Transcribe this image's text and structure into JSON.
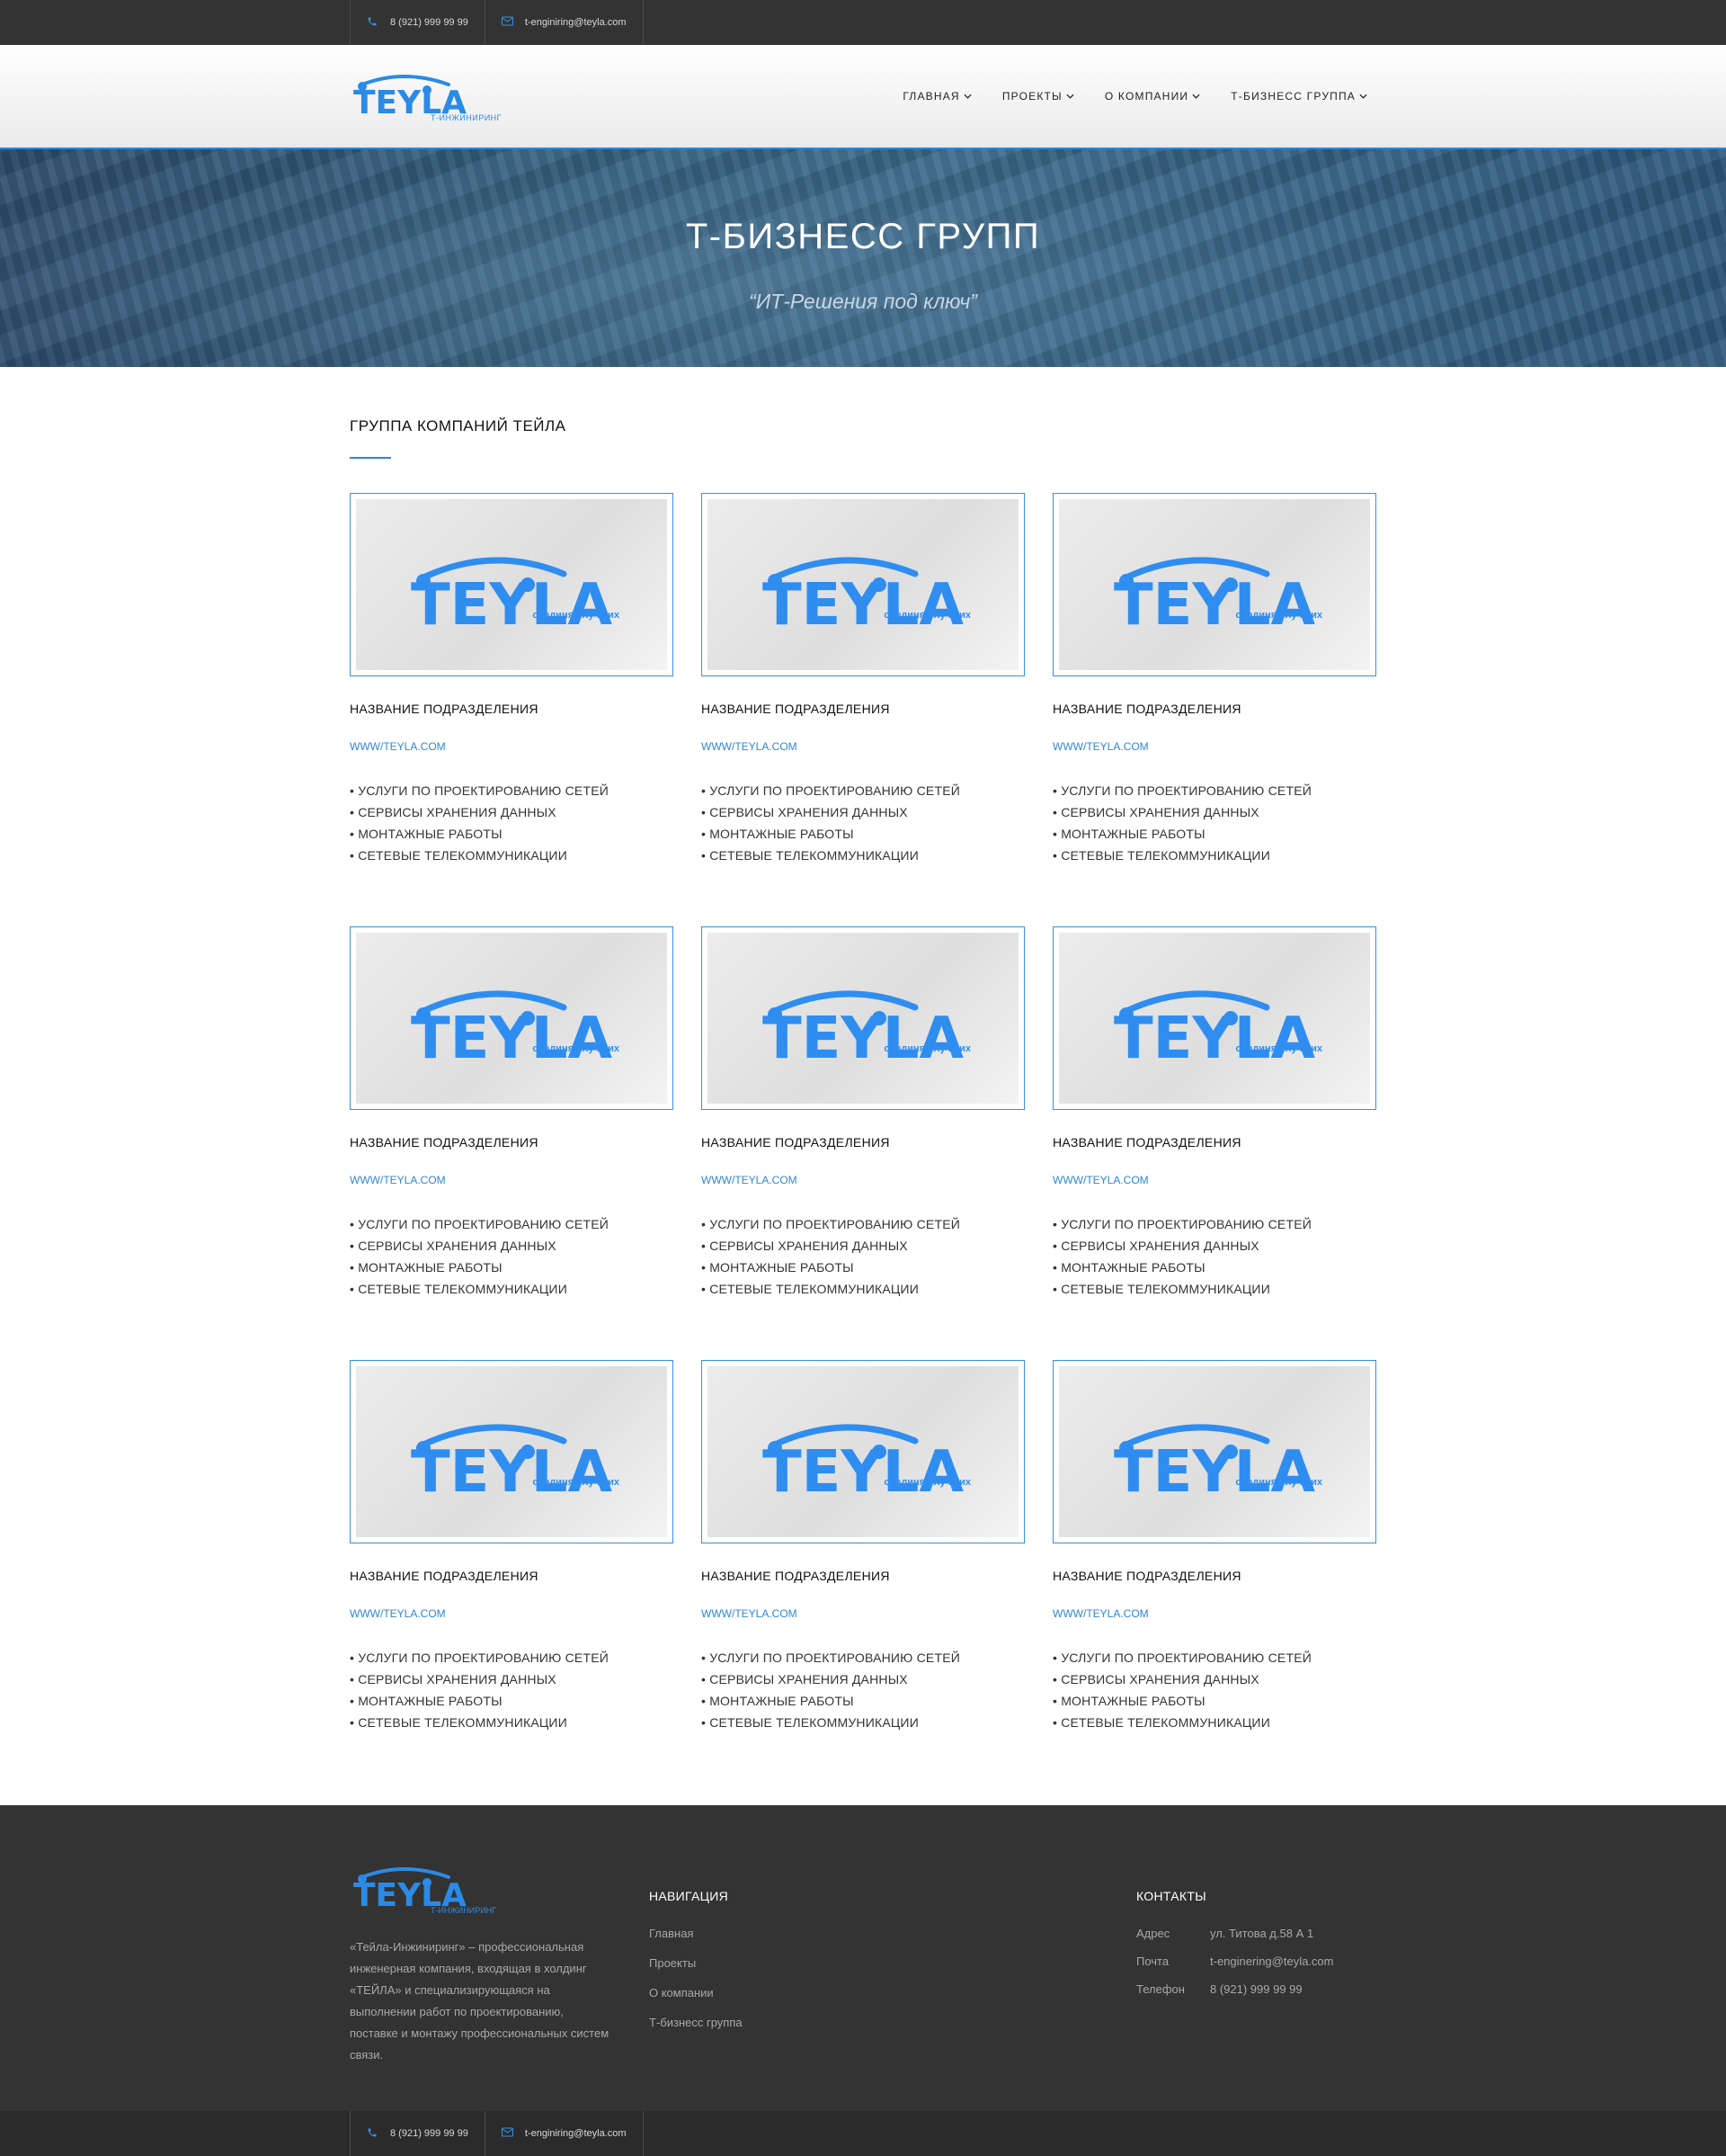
{
  "topbar": {
    "phone": "8 (921) 999 99 99",
    "email": "t-enginiring@teyla.com"
  },
  "brand": {
    "logo_text": "TEYLA",
    "logo_sub": "Т-ИНЖИНИРИНГ",
    "accent": "#2b8ae6",
    "dark": "#333333"
  },
  "nav": {
    "items": [
      {
        "label": "ГЛАВНАЯ"
      },
      {
        "label": "ПРОЕКТЫ"
      },
      {
        "label": "О КОМПАНИИ"
      },
      {
        "label": "Т-БИЗНЕСС ГРУППА"
      }
    ]
  },
  "hero": {
    "title": "Т-БИЗНЕСС ГРУПП",
    "quote": "“ИТ-Решения под ключ”"
  },
  "section": {
    "title": "ГРУППА КОМПАНИЙ ТЕЙЛА"
  },
  "cards": [
    {
      "logo_text": "TEYLA",
      "tagline": "соединяя лучших",
      "name": "НАЗВАНИЕ ПОДРАЗДЕЛЕНИЯ",
      "link": "WWW/TEYLA.COM",
      "services": [
        "• УСЛУГИ ПО ПРОЕКТИРОВАНИЮ СЕТЕЙ",
        "• СЕРВИСЫ ХРАНЕНИЯ ДАННЫХ",
        "• МОНТАЖНЫЕ РАБОТЫ",
        "• СЕТЕВЫЕ ТЕЛЕКОММУНИКАЦИИ"
      ]
    },
    {
      "logo_text": "TEYLA",
      "tagline": "соединяя лучших",
      "name": "НАЗВАНИЕ ПОДРАЗДЕЛЕНИЯ",
      "link": "WWW/TEYLA.COM",
      "services": [
        "• УСЛУГИ ПО ПРОЕКТИРОВАНИЮ СЕТЕЙ",
        "• СЕРВИСЫ ХРАНЕНИЯ ДАННЫХ",
        "• МОНТАЖНЫЕ РАБОТЫ",
        "• СЕТЕВЫЕ ТЕЛЕКОММУНИКАЦИИ"
      ]
    },
    {
      "logo_text": "TEYLA",
      "tagline": "соединяя лучших",
      "name": "НАЗВАНИЕ ПОДРАЗДЕЛЕНИЯ",
      "link": "WWW/TEYLA.COM",
      "services": [
        "• УСЛУГИ ПО ПРОЕКТИРОВАНИЮ СЕТЕЙ",
        "• СЕРВИСЫ ХРАНЕНИЯ ДАННЫХ",
        "• МОНТАЖНЫЕ РАБОТЫ",
        "• СЕТЕВЫЕ ТЕЛЕКОММУНИКАЦИИ"
      ]
    },
    {
      "logo_text": "TEYLA",
      "tagline": "соединяя лучших",
      "name": "НАЗВАНИЕ ПОДРАЗДЕЛЕНИЯ",
      "link": "WWW/TEYLA.COM",
      "services": [
        "• УСЛУГИ ПО ПРОЕКТИРОВАНИЮ СЕТЕЙ",
        "• СЕРВИСЫ ХРАНЕНИЯ ДАННЫХ",
        "• МОНТАЖНЫЕ РАБОТЫ",
        "• СЕТЕВЫЕ ТЕЛЕКОММУНИКАЦИИ"
      ]
    },
    {
      "logo_text": "TEYLA",
      "tagline": "соединяя лучших",
      "name": "НАЗВАНИЕ ПОДРАЗДЕЛЕНИЯ",
      "link": "WWW/TEYLA.COM",
      "services": [
        "• УСЛУГИ ПО ПРОЕКТИРОВАНИЮ СЕТЕЙ",
        "• СЕРВИСЫ ХРАНЕНИЯ ДАННЫХ",
        "• МОНТАЖНЫЕ РАБОТЫ",
        "• СЕТЕВЫЕ ТЕЛЕКОММУНИКАЦИИ"
      ]
    },
    {
      "logo_text": "TEYLA",
      "tagline": "соединяя лучших",
      "name": "НАЗВАНИЕ ПОДРАЗДЕЛЕНИЯ",
      "link": "WWW/TEYLA.COM",
      "services": [
        "• УСЛУГИ ПО ПРОЕКТИРОВАНИЮ СЕТЕЙ",
        "• СЕРВИСЫ ХРАНЕНИЯ ДАННЫХ",
        "• МОНТАЖНЫЕ РАБОТЫ",
        "• СЕТЕВЫЕ ТЕЛЕКОММУНИКАЦИИ"
      ]
    },
    {
      "logo_text": "TEYLA",
      "tagline": "соединяя лучших",
      "name": "НАЗВАНИЕ ПОДРАЗДЕЛЕНИЯ",
      "link": "WWW/TEYLA.COM",
      "services": [
        "• УСЛУГИ ПО ПРОЕКТИРОВАНИЮ СЕТЕЙ",
        "• СЕРВИСЫ ХРАНЕНИЯ ДАННЫХ",
        "• МОНТАЖНЫЕ РАБОТЫ",
        "• СЕТЕВЫЕ ТЕЛЕКОММУНИКАЦИИ"
      ]
    },
    {
      "logo_text": "TEYLA",
      "tagline": "соединяя лучших",
      "name": "НАЗВАНИЕ ПОДРАЗДЕЛЕНИЯ",
      "link": "WWW/TEYLA.COM",
      "services": [
        "• УСЛУГИ ПО ПРОЕКТИРОВАНИЮ СЕТЕЙ",
        "• СЕРВИСЫ ХРАНЕНИЯ ДАННЫХ",
        "• МОНТАЖНЫЕ РАБОТЫ",
        "• СЕТЕВЫЕ ТЕЛЕКОММУНИКАЦИИ"
      ]
    },
    {
      "logo_text": "TEYLA",
      "tagline": "соединяя лучших",
      "name": "НАЗВАНИЕ ПОДРАЗДЕЛЕНИЯ",
      "link": "WWW/TEYLA.COM",
      "services": [
        "• УСЛУГИ ПО ПРОЕКТИРОВАНИЮ СЕТЕЙ",
        "• СЕРВИСЫ ХРАНЕНИЯ ДАННЫХ",
        "• МОНТАЖНЫЕ РАБОТЫ",
        "• СЕТЕВЫЕ ТЕЛЕКОММУНИКАЦИИ"
      ]
    }
  ],
  "footer": {
    "logo_text": "TEYLA",
    "logo_sub": "Т-ИНЖИНИРИНГ",
    "description": "«Тейла-Инжиниринг» – профессиональная инженерная компания, входящая в холдинг «ТЕЙЛА» и специализирующаяся на выполнении работ по проектированию, поставке и монтажу профессиональных систем связи.",
    "nav_heading": "НАВИГАЦИЯ",
    "nav_items": [
      "Главная",
      "Проекты",
      "О компании",
      "Т-бизнесс группа"
    ],
    "contacts_heading": "КОНТАКТЫ",
    "contacts": [
      {
        "label": "Адрес",
        "value": "ул. Титова д.58 А 1"
      },
      {
        "label": "Почта",
        "value": "t-enginering@teyla.com"
      },
      {
        "label": "Телефон",
        "value": "8 (921) 999 99 99"
      }
    ]
  },
  "bottombar": {
    "phone": "8 (921) 999 99 99",
    "email": "t-enginiring@teyla.com"
  }
}
